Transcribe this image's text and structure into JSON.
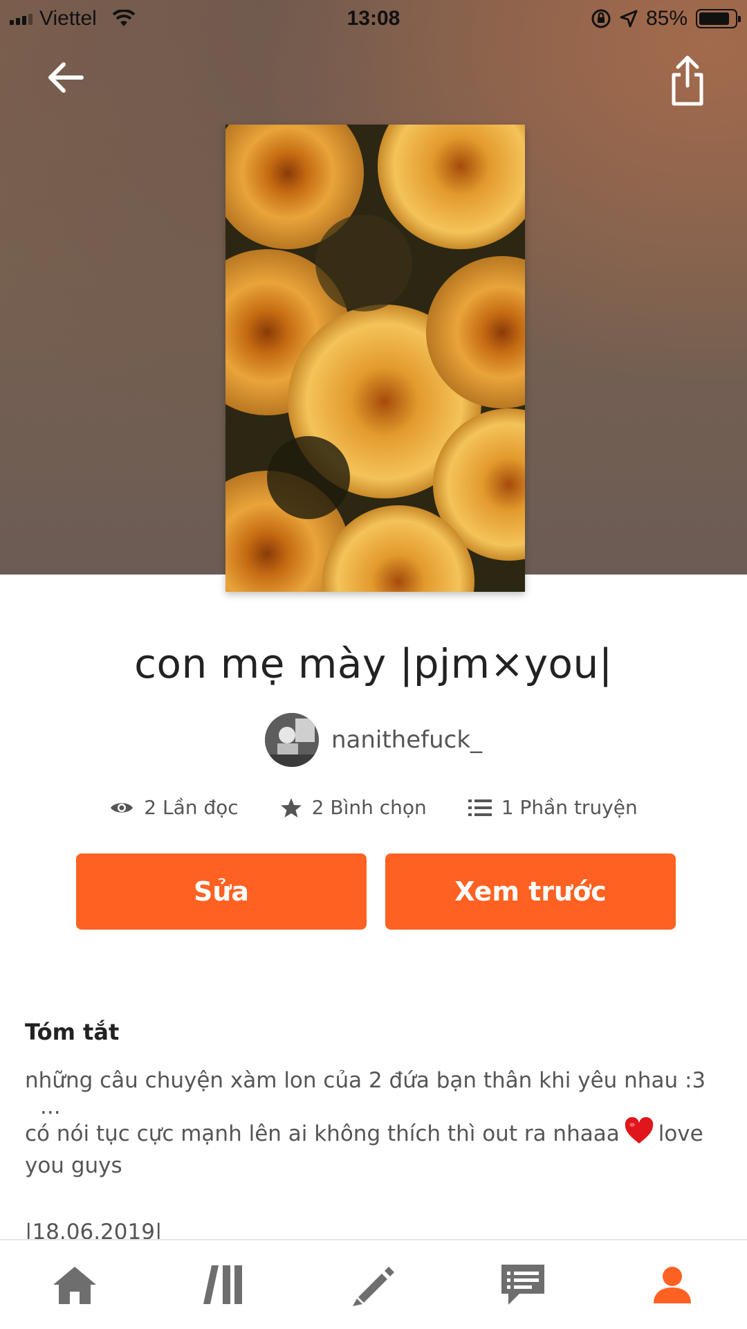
{
  "status_bar": {
    "carrier": "Viettel",
    "time": "13:08",
    "battery_percent": "85%",
    "battery_level": 0.85
  },
  "header": {
    "back_icon": "arrow-left-icon",
    "share_icon": "share-icon"
  },
  "story": {
    "title": "con mẹ mày |pjm×you|",
    "author": "nanithefuck_",
    "stats": [
      {
        "icon": "eye-icon",
        "label": "2 Lần đọc"
      },
      {
        "icon": "star-icon",
        "label": "2 Bình chọn"
      },
      {
        "icon": "list-icon",
        "label": "1 Phần truyện"
      }
    ]
  },
  "actions": {
    "edit_label": "Sửa",
    "preview_label": "Xem trước"
  },
  "summary": {
    "heading": "Tóm tắt",
    "line1": "những câu chuyện xàm lon của 2 đứa bạn thân khi yêu nhau :3",
    "ellipsis": "...",
    "line2_before_heart": "có nói tục cực mạnh lên ai không thích thì out ra nhaaa",
    "line2_after_heart": "love",
    "line3": "you guys",
    "date": "|18.06.2019|"
  },
  "nav": {
    "items": [
      {
        "name": "home",
        "icon": "home-icon",
        "active": false
      },
      {
        "name": "library",
        "icon": "library-icon",
        "active": false
      },
      {
        "name": "write",
        "icon": "pencil-icon",
        "active": false
      },
      {
        "name": "messages",
        "icon": "chat-icon",
        "active": false
      },
      {
        "name": "profile",
        "icon": "user-icon",
        "active": true
      }
    ],
    "active_color": "#ff6122",
    "inactive_color": "#6e6e6e"
  },
  "colors": {
    "accent": "#ff6122",
    "heart": "#e0161b"
  }
}
